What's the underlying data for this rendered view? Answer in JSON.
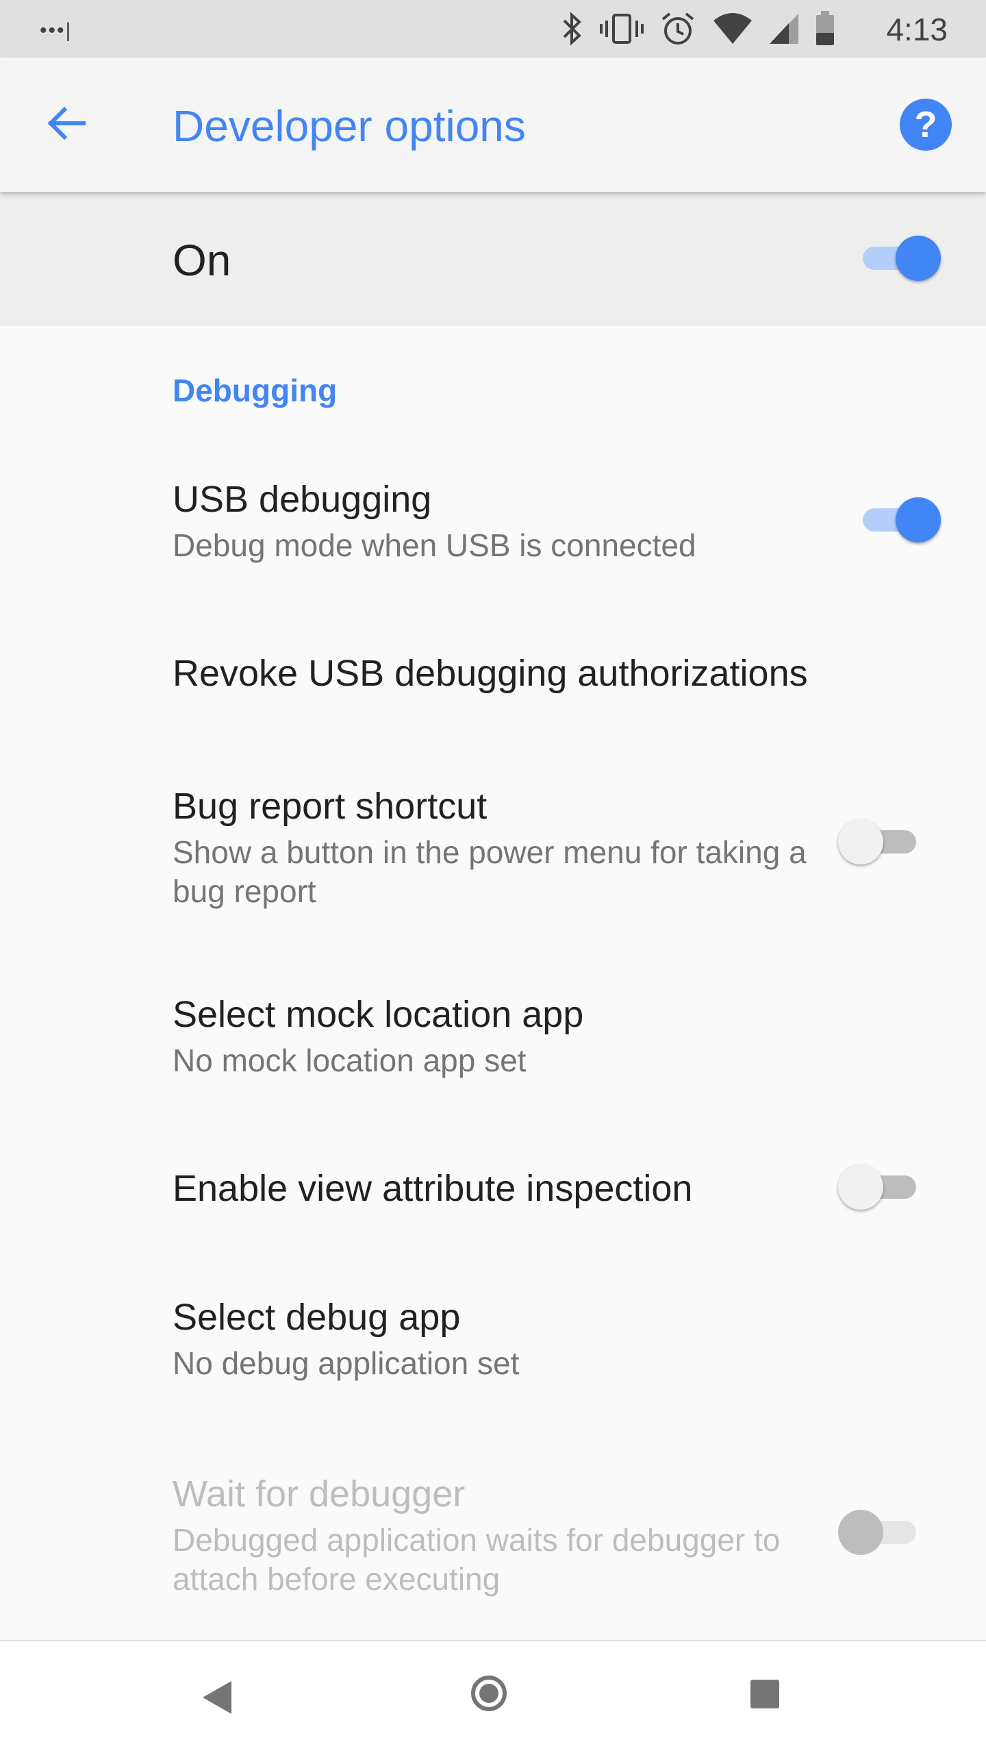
{
  "status_bar": {
    "signal_dots": "•••|",
    "time": "4:13",
    "icons": [
      "bluetooth-icon",
      "vibrate-icon",
      "alarm-icon",
      "wifi-icon",
      "cell-signal-icon",
      "battery-icon"
    ]
  },
  "app_bar": {
    "title": "Developer options",
    "back_icon": "arrow-back-icon",
    "help_icon": "help-icon",
    "help_glyph": "?"
  },
  "master_switch": {
    "label": "On",
    "checked": true
  },
  "sections": [
    {
      "header": "Debugging",
      "items": [
        {
          "title": "USB debugging",
          "summary": "Debug mode when USB is connected",
          "switch": "on"
        },
        {
          "title": "Revoke USB debugging authorizations"
        },
        {
          "title": "Bug report shortcut",
          "summary": "Show a button in the power menu for taking a bug report",
          "switch": "off"
        },
        {
          "title": "Select mock location app",
          "summary": "No mock location app set"
        },
        {
          "title": "Enable view attribute inspection",
          "switch": "off"
        },
        {
          "title": "Select debug app",
          "summary": "No debug application set"
        },
        {
          "title": "Wait for debugger",
          "summary": "Debugged application waits for debugger to attach before executing",
          "switch": "disabled",
          "disabled": true
        }
      ]
    }
  ],
  "colors": {
    "accent": "#4285f4",
    "status_bar_bg": "#e0e0e0",
    "app_bar_bg": "#f5f5f5",
    "master_row_bg": "#eeeeee",
    "page_bg": "#fafafa"
  }
}
